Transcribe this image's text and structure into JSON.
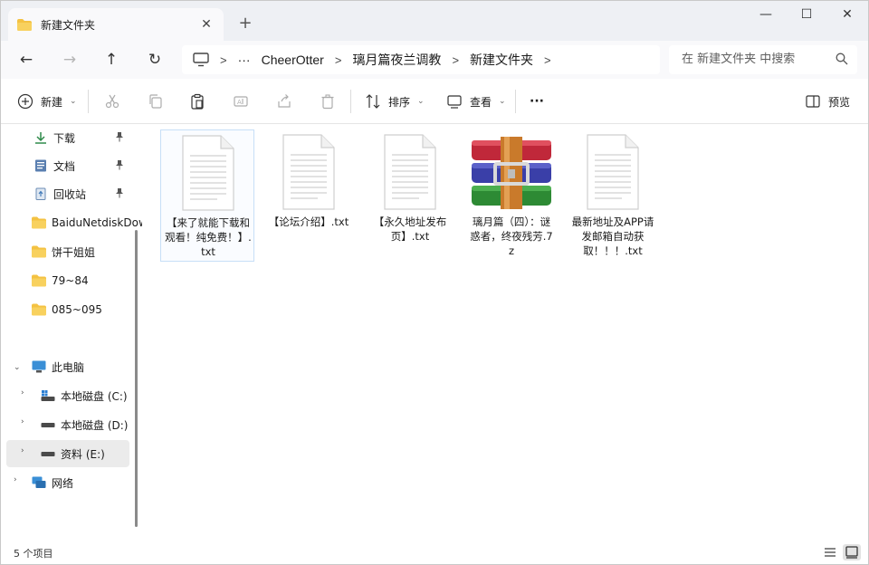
{
  "window": {
    "tab_title": "新建文件夹",
    "tab_close": "✕",
    "new_tab": "+",
    "minimize": "—",
    "maximize": "☐",
    "close": "✕"
  },
  "address": {
    "ellipsis": "···",
    "breadcrumbs": [
      "CheerOtter",
      "璃月篇夜兰调教",
      "新建文件夹"
    ],
    "separator": ">",
    "search_placeholder": "在 新建文件夹 中搜索"
  },
  "nav_buttons": {
    "back": "←",
    "forward": "→",
    "up": "↑",
    "refresh": "↻"
  },
  "toolbar": {
    "new_label": "新建",
    "sort_label": "排序",
    "view_label": "查看",
    "more_label": "···",
    "preview_label": "预览",
    "caret": "⌄"
  },
  "sidebar": {
    "quick_access": [
      {
        "label": "下载",
        "icon": "download-icon",
        "pinned": true
      },
      {
        "label": "文档",
        "icon": "document-icon",
        "pinned": true
      },
      {
        "label": "回收站",
        "icon": "recycle-bin-icon",
        "pinned": true
      },
      {
        "label": "BaiduNetdiskDownload",
        "icon": "folder-icon",
        "pinned": false
      },
      {
        "label": "饼干姐姐",
        "icon": "folder-icon",
        "pinned": false
      },
      {
        "label": "79~84",
        "icon": "folder-icon",
        "pinned": false
      },
      {
        "label": "085~095",
        "icon": "folder-icon",
        "pinned": false
      }
    ],
    "this_pc": "此电脑",
    "drives": [
      {
        "label": "本地磁盘 (C:)",
        "icon": "system-drive-icon"
      },
      {
        "label": "本地磁盘 (D:)",
        "icon": "drive-icon"
      },
      {
        "label": "资料 (E:)",
        "icon": "drive-icon"
      }
    ],
    "network": "网络"
  },
  "files": [
    {
      "name": "【来了就能下载和观看！纯免费！】.txt",
      "type": "txt",
      "selected": true
    },
    {
      "name": "【论坛介绍】.txt",
      "type": "txt",
      "selected": false
    },
    {
      "name": "【永久地址发布页】.txt",
      "type": "txt",
      "selected": false
    },
    {
      "name": "璃月篇（四）：谜惑者，终夜残芳.7z",
      "type": "archive",
      "selected": false
    },
    {
      "name": "最新地址及APP请发邮箱自动获取！！！.txt",
      "type": "txt",
      "selected": false
    }
  ],
  "status": {
    "item_count": "5 个项目"
  },
  "colors": {
    "folder": "#f4c242",
    "selection_border": "#c7dff7",
    "chrome_bg": "#eef0f4",
    "address_bg": "#f9f9fb"
  }
}
